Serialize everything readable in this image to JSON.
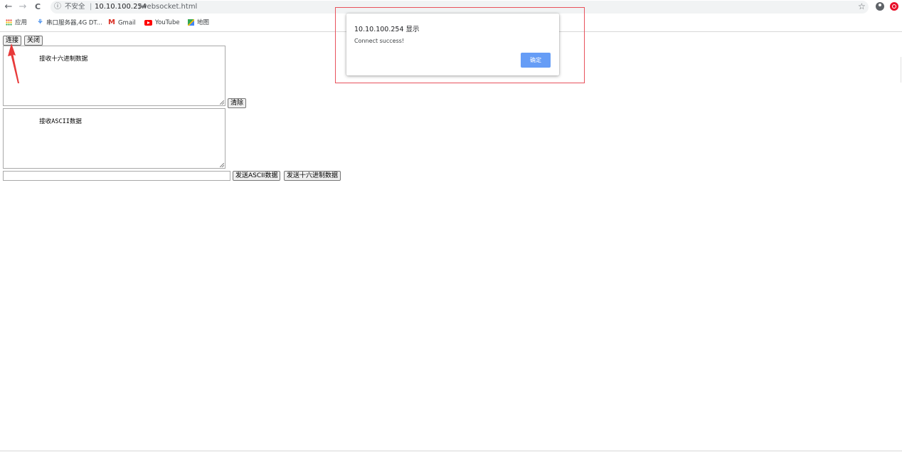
{
  "browser": {
    "security_text": "不安全",
    "separator": "|",
    "url_host": "10.10.100.254",
    "url_path": "/websocket.html",
    "back_glyph": "←",
    "forward_glyph": "→",
    "reload_glyph": "C",
    "info_glyph": "ⓘ",
    "star_glyph": "☆"
  },
  "bookmarks": [
    {
      "label": "应用",
      "icon": "apps-grid-icon"
    },
    {
      "label": "串口服务器,4G DT...",
      "icon": "serial-server-icon"
    },
    {
      "label": "Gmail",
      "icon": "gmail-icon"
    },
    {
      "label": "YouTube",
      "icon": "youtube-icon"
    },
    {
      "label": "地图",
      "icon": "maps-icon"
    }
  ],
  "page": {
    "connect_label": "连接",
    "close_label": "关闭",
    "hex_area_text": "接收十六进制数据",
    "clear_label": "清除",
    "ascii_area_text": "接收ASCII数据",
    "send_input_value": "",
    "send_ascii_label": "发送ASCII数据",
    "send_hex_label": "发送十六进制数据"
  },
  "dialog": {
    "title": "10.10.100.254 显示",
    "message": "Connect success!",
    "ok_label": "确定"
  },
  "colors": {
    "dialog_button": "#669df6",
    "annotation_red": "#e8525c",
    "arrow_red": "#e83a3a"
  }
}
